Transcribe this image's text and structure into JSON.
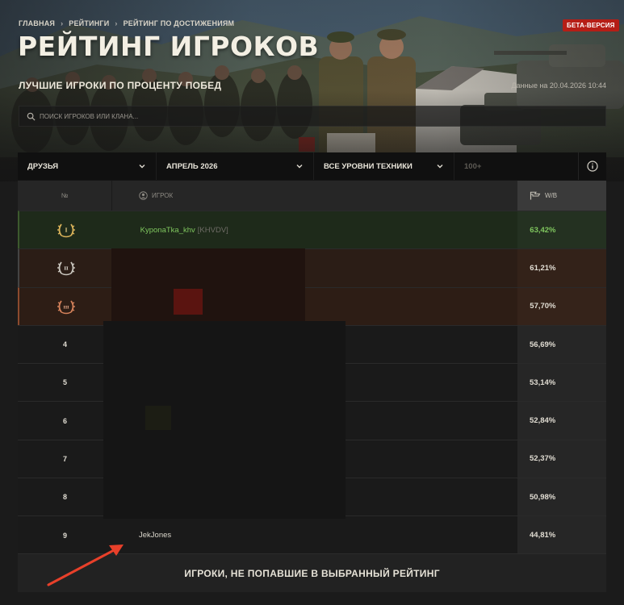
{
  "breadcrumb": [
    "ГЛАВНАЯ",
    "РЕЙТИНГИ",
    "РЕЙТИНГ ПО ДОСТИЖЕНИЯМ"
  ],
  "title": "РЕЙТИНГ ИГРОКОВ",
  "subtitle": "ЛУЧШИЕ ИГРОКИ ПО ПРОЦЕНТУ ПОБЕД",
  "beta_label": "БЕТА-ВЕРСИЯ",
  "data_date": "Данные на 20.04.2026 10:44",
  "search": {
    "placeholder": "ПОИСК ИГРОКОВ ИЛИ КЛАНА..."
  },
  "filters": {
    "group": "ДРУЗЬЯ",
    "period": "АПРЕЛЬ 2026",
    "tier": "ВСЕ УРОВНИ ТЕХНИКИ",
    "battles": "100+"
  },
  "table": {
    "col_num": "№",
    "col_player": "ИГРОК",
    "col_wr": "W/B",
    "rows": [
      {
        "rank": "I",
        "name": "KyponaTka_khv",
        "clan": "[KHVDV]",
        "wr": "63,42%"
      },
      {
        "rank": "II",
        "name": "",
        "clan": "",
        "wr": "61,21%"
      },
      {
        "rank": "III",
        "name": "",
        "clan": "",
        "wr": "57,70%"
      },
      {
        "rank": "4",
        "name": "",
        "clan": "",
        "wr": "56,69%"
      },
      {
        "rank": "5",
        "name": "",
        "clan": "",
        "wr": "53,14%"
      },
      {
        "rank": "6",
        "name": "",
        "clan": "",
        "wr": "52,84%"
      },
      {
        "rank": "7",
        "name": "",
        "clan": "",
        "wr": "52,37%"
      },
      {
        "rank": "8",
        "name": "",
        "clan": "",
        "wr": "50,98%"
      },
      {
        "rank": "9",
        "name": "JekJones",
        "clan": "",
        "wr": "44,81%"
      }
    ]
  },
  "footer_button": "ИГРОКИ, НЕ ПОПАВШИЕ В ВЫБРАННЫЙ РЕЙТИНГ",
  "colors": {
    "accent_red": "#b51e16",
    "win_green": "#7fc65e",
    "annotation_arrow": "#e8402a"
  }
}
